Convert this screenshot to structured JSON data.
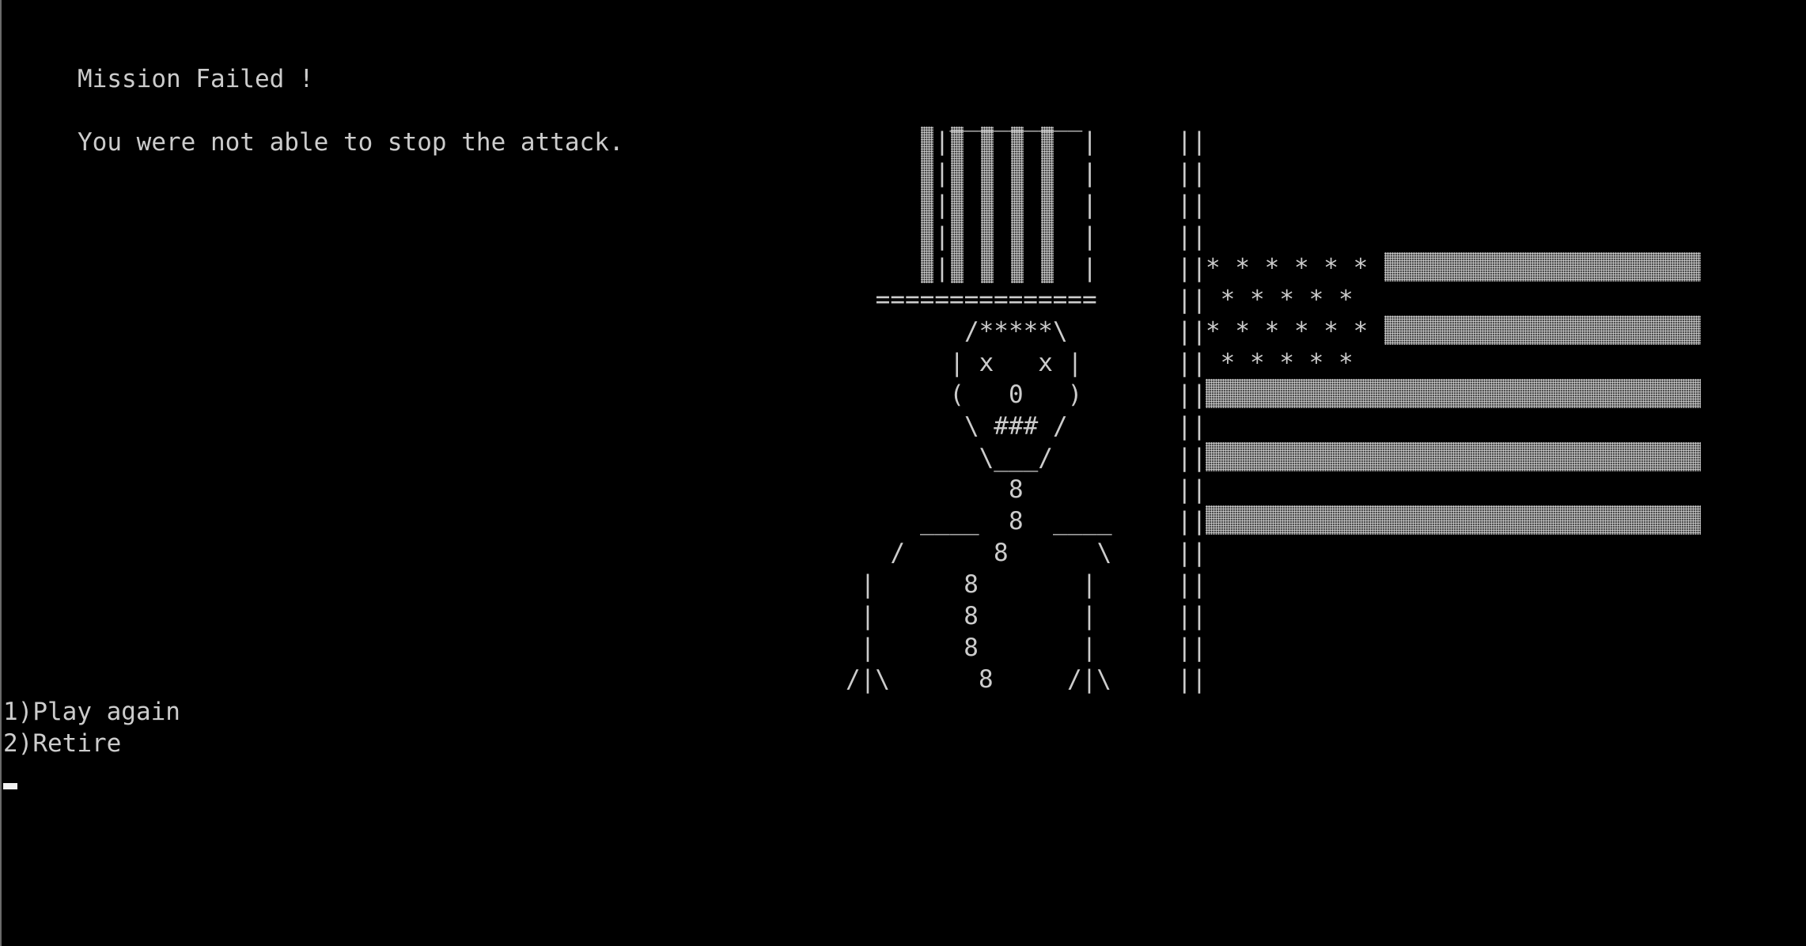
{
  "console": {
    "title_line": "Mission Failed !",
    "message_line": "You were not able to stop the attack.",
    "options": [
      "1)Play again",
      "2)Retire"
    ]
  },
  "art": {
    "uncle_sam": [
      "     _________",
      "    |         |",
      "    |         |",
      "    |         |",
      "    |         |",
      "    |         |",
      " ===============",
      "      /*****\\",
      "     | x   x |",
      "     (   0   )",
      "      \\ ### /",
      "       \\___/",
      "         8",
      "   ____  8  ____",
      "  /      8      \\",
      " |      8       |",
      " |      8       |",
      " |      8       |",
      "/|\\      8     /|\\"
    ],
    "flag_pole": [
      "||",
      "||",
      "||",
      "||",
      "||",
      "||",
      "||",
      "||",
      "||",
      "||",
      "||",
      "||",
      "||",
      "||",
      "||",
      "||",
      "||",
      "||"
    ],
    "flag_stars": [
      "* * * * * *",
      " * * * * *",
      "* * * * * *",
      " * * * * *"
    ]
  },
  "colors": {
    "background": "#000000",
    "text": "#cccccc",
    "shade": "#8a8a8a",
    "cursor": "#f2f2f2"
  }
}
